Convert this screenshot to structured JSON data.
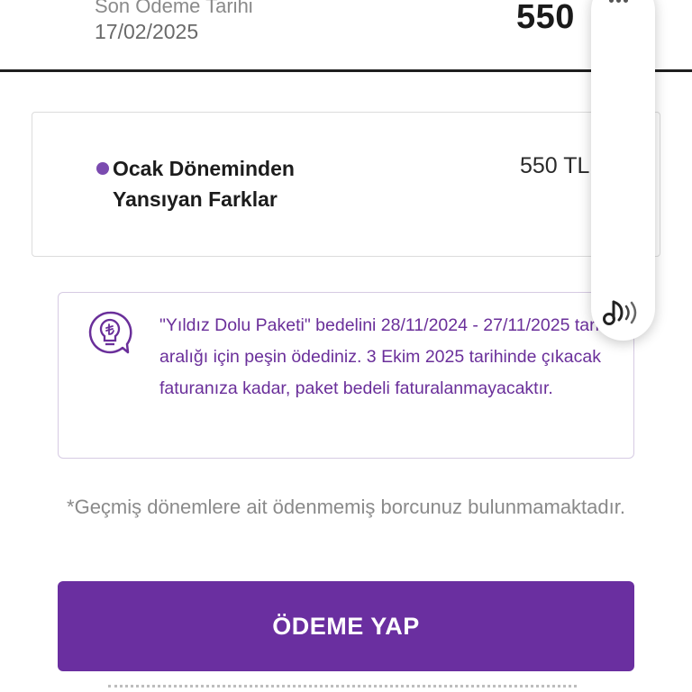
{
  "header": {
    "due_label": "Son Ödeme Tarihi",
    "due_date": "17/02/2025",
    "amount": "550"
  },
  "item": {
    "title": "Ocak Döneminden Yansıyan Farklar",
    "amount": "550 TL"
  },
  "info": {
    "icon": "lightbulb-lira-icon",
    "text": "\"Yıldız Dolu Paketi\" bedelini 28/11/2024 - 27/11/2025 tarih aralığı için peşin ödediniz. 3 Ekim 2025 tarihinde çıkacak faturanıza kadar, paket bedeli faturalanmayacaktır."
  },
  "note": "*Geçmiş dönemlere ait ödenmemiş borcunuz bulunmamaktadır.",
  "pay_button": "ÖDEME YAP",
  "side_panel": {
    "icon": "audio-read-aloud-icon"
  },
  "colors": {
    "accent": "#6a2fa0",
    "info_text": "#6a2f9a",
    "dot": "#7b4bb0"
  }
}
